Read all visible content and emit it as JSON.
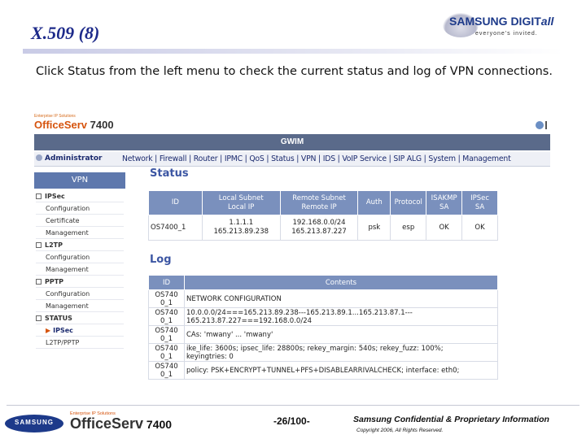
{
  "slide": {
    "title": "X.509 (8)",
    "intro": "Click Status from the left menu to check the current status and log of VPN connections."
  },
  "brand": {
    "name": "SAMSUNG DIGIT",
    "name_tail": "all",
    "tagline": "everyone's invited."
  },
  "app": {
    "logo_tag": "Enterprise IP Solutions",
    "logo_name": "OfficeServ",
    "logo_model": " 7400",
    "header": "GWIM",
    "admin_label": "Administrator",
    "menu": "Network | Firewall | Router | IPMC | QoS | Status | VPN | IDS | VoIP Service | SIP ALG | System | Management"
  },
  "sidebar": {
    "heading": "VPN",
    "items": [
      {
        "label": "IPSec",
        "type": "group"
      },
      {
        "label": "Configuration",
        "type": "sub"
      },
      {
        "label": "Certificate",
        "type": "sub"
      },
      {
        "label": "Management",
        "type": "sub"
      },
      {
        "label": "L2TP",
        "type": "group"
      },
      {
        "label": "Configuration",
        "type": "sub"
      },
      {
        "label": "Management",
        "type": "sub"
      },
      {
        "label": "PPTP",
        "type": "group"
      },
      {
        "label": "Configuration",
        "type": "sub"
      },
      {
        "label": "Management",
        "type": "sub"
      },
      {
        "label": "STATUS",
        "type": "group"
      },
      {
        "label": "IPSec",
        "type": "active"
      },
      {
        "label": "L2TP/PPTP",
        "type": "sub"
      }
    ]
  },
  "status": {
    "title": "Status",
    "headers": [
      "ID",
      "Local Subnet\nLocal IP",
      "Remote Subnet\nRemote IP",
      "Auth",
      "Protocol",
      "ISAKMP\nSA",
      "IPSec\nSA"
    ],
    "row": {
      "id": "OS7400_1",
      "local": "1.1.1.1\n165.213.89.238",
      "remote": "192.168.0.0/24\n165.213.87.227",
      "auth": "psk",
      "protocol": "esp",
      "isakmp": "OK",
      "ipsec": "OK"
    }
  },
  "log": {
    "title": "Log",
    "headers": [
      "ID",
      "Contents"
    ],
    "rows": [
      {
        "id": "OS740\n0_1",
        "content": "NETWORK CONFIGURATION"
      },
      {
        "id": "OS740\n0_1",
        "content": "10.0.0.0/24===165.213.89.238---165.213.89.1...165.213.87.1---\n165.213.87.227===192.168.0.0/24"
      },
      {
        "id": "OS740\n0_1",
        "content": "CAs: 'mwany' ... 'mwany'"
      },
      {
        "id": "OS740\n0_1",
        "content": "ike_life: 3600s; ipsec_life: 28800s; rekey_margin: 540s; rekey_fuzz: 100%;\nkeyingtries: 0"
      },
      {
        "id": "OS740\n0_1",
        "content": "policy: PSK+ENCRYPT+TUNNEL+PFS+DISABLEARRIVALCHECK; interface: eth0;"
      }
    ]
  },
  "footer": {
    "logo": "SAMSUNG",
    "tag": "Enterprise IP Solutions",
    "product": "OfficeServ",
    "model": " 7400",
    "page": "-26/100-",
    "confidential": "Samsung Confidential & Proprietary Information",
    "copyright": "Copyright 2006, All Rights Reserved."
  },
  "colors": {
    "title": "#1d2a8a",
    "header_bar": "#5a6a8a",
    "table_header": "#7a90bd",
    "section_title": "#3c56a3",
    "accent_orange": "#d6540e"
  }
}
